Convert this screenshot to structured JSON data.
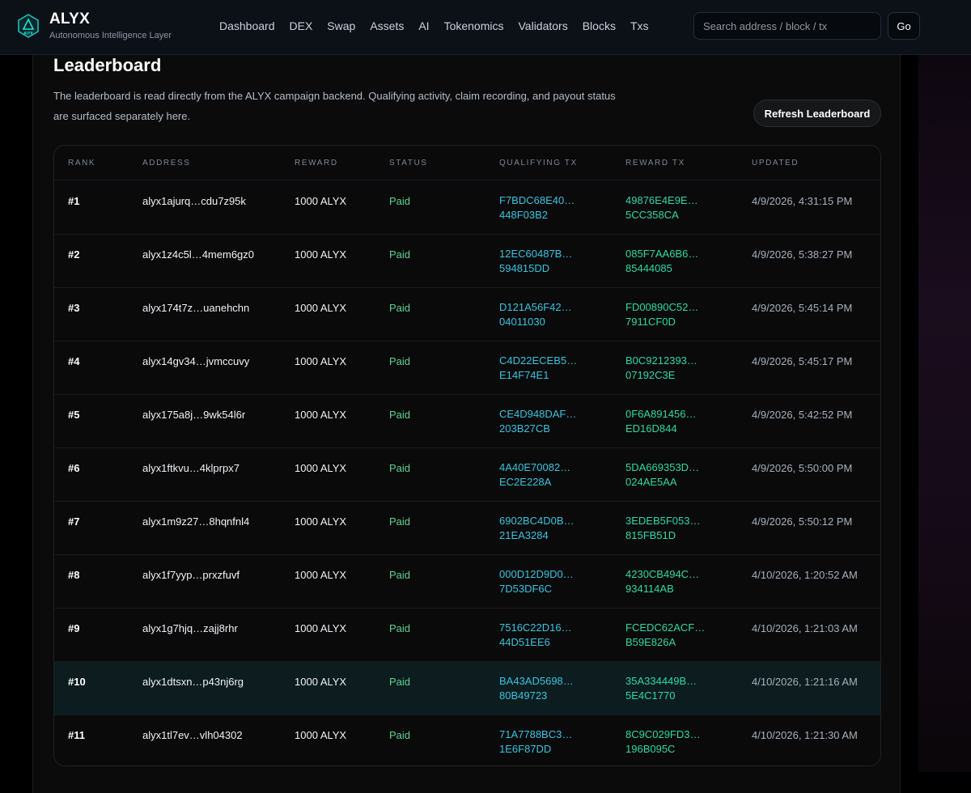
{
  "brand": {
    "name": "ALYX",
    "subtitle": "Autonomous Intelligence Layer",
    "logo_text": "ALYX"
  },
  "nav": [
    "Dashboard",
    "DEX",
    "Swap",
    "Assets",
    "AI",
    "Tokenomics",
    "Validators",
    "Blocks",
    "Txs"
  ],
  "search": {
    "placeholder": "Search address / block / tx",
    "go_label": "Go"
  },
  "page": {
    "title": "Leaderboard",
    "description": "The leaderboard is read directly from the ALYX campaign backend. Qualifying activity, claim recording, and payout status are surfaced separately here.",
    "refresh_label": "Refresh Leaderboard"
  },
  "table": {
    "columns": [
      "Rank",
      "Address",
      "Reward",
      "Status",
      "Qualifying TX",
      "Reward TX",
      "Updated"
    ],
    "highlight_row": 9,
    "rows": [
      {
        "rank": "#1",
        "address": "alyx1ajurq…cdu7z95k",
        "reward": "1000 ALYX",
        "status": "Paid",
        "qtx1": "F7BDC68E40…",
        "qtx2": "448F03B2",
        "rtx1": "49876E4E9E…",
        "rtx2": "5CC358CA",
        "updated": "4/9/2026, 4:31:15 PM"
      },
      {
        "rank": "#2",
        "address": "alyx1z4c5l…4mem6gz0",
        "reward": "1000 ALYX",
        "status": "Paid",
        "qtx1": "12EC60487B…",
        "qtx2": "594815DD",
        "rtx1": "085F7AA6B6…",
        "rtx2": "85444085",
        "updated": "4/9/2026, 5:38:27 PM"
      },
      {
        "rank": "#3",
        "address": "alyx174t7z…uanehchn",
        "reward": "1000 ALYX",
        "status": "Paid",
        "qtx1": "D121A56F42…",
        "qtx2": "04011030",
        "rtx1": "FD00890C52…",
        "rtx2": "7911CF0D",
        "updated": "4/9/2026, 5:45:14 PM"
      },
      {
        "rank": "#4",
        "address": "alyx14gv34…jvmccuvy",
        "reward": "1000 ALYX",
        "status": "Paid",
        "qtx1": "C4D22ECEB5…",
        "qtx2": "E14F74E1",
        "rtx1": "B0C9212393…",
        "rtx2": "07192C3E",
        "updated": "4/9/2026, 5:45:17 PM"
      },
      {
        "rank": "#5",
        "address": "alyx175a8j…9wk54l6r",
        "reward": "1000 ALYX",
        "status": "Paid",
        "qtx1": "CE4D948DAF…",
        "qtx2": "203B27CB",
        "rtx1": "0F6A891456…",
        "rtx2": "ED16D844",
        "updated": "4/9/2026, 5:42:52 PM"
      },
      {
        "rank": "#6",
        "address": "alyx1ftkvu…4klprpx7",
        "reward": "1000 ALYX",
        "status": "Paid",
        "qtx1": "4A40E70082…",
        "qtx2": "EC2E228A",
        "rtx1": "5DA669353D…",
        "rtx2": "024AE5AA",
        "updated": "4/9/2026, 5:50:00 PM"
      },
      {
        "rank": "#7",
        "address": "alyx1m9z27…8hqnfnl4",
        "reward": "1000 ALYX",
        "status": "Paid",
        "qtx1": "6902BC4D0B…",
        "qtx2": "21EA3284",
        "rtx1": "3EDEB5F053…",
        "rtx2": "815FB51D",
        "updated": "4/9/2026, 5:50:12 PM"
      },
      {
        "rank": "#8",
        "address": "alyx1f7yyp…prxzfuvf",
        "reward": "1000 ALYX",
        "status": "Paid",
        "qtx1": "000D12D9D0…",
        "qtx2": "7D53DF6C",
        "rtx1": "4230CB494C…",
        "rtx2": "934114AB",
        "updated": "4/10/2026, 1:20:52 AM"
      },
      {
        "rank": "#9",
        "address": "alyx1g7hjq…zajj8rhr",
        "reward": "1000 ALYX",
        "status": "Paid",
        "qtx1": "7516C22D16…",
        "qtx2": "44D51EE6",
        "rtx1": "FCEDC62ACF…",
        "rtx2": "B59E826A",
        "updated": "4/10/2026, 1:21:03 AM"
      },
      {
        "rank": "#10",
        "address": "alyx1dtsxn…p43nj6rg",
        "reward": "1000 ALYX",
        "status": "Paid",
        "qtx1": "BA43AD5698…",
        "qtx2": "80B49723",
        "rtx1": "35A334449B…",
        "rtx2": "5E4C1770",
        "updated": "4/10/2026, 1:21:16 AM"
      },
      {
        "rank": "#11",
        "address": "alyx1tl7ev…vlh04302",
        "reward": "1000 ALYX",
        "status": "Paid",
        "qtx1": "71A7788BC3…",
        "qtx2": "1E6F87DD",
        "rtx1": "8C9C029FD3…",
        "rtx2": "196B095C",
        "updated": "4/10/2026, 1:21:30 AM"
      }
    ]
  }
}
